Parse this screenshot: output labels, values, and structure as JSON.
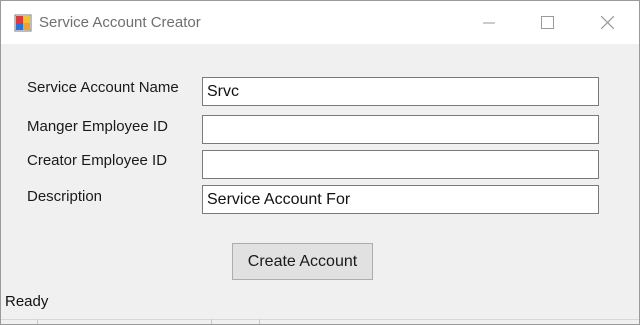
{
  "window": {
    "title": "Service Account Creator",
    "icon": "app-icon",
    "controls": {
      "minimize": "minimize-icon",
      "maximize": "maximize-icon",
      "close": "close-icon"
    }
  },
  "form": {
    "fields": [
      {
        "label": "Service Account Name",
        "value": "Srvc",
        "placeholder": ""
      },
      {
        "label": "Manger Employee ID",
        "value": "",
        "placeholder": ""
      },
      {
        "label": "Creator Employee ID",
        "value": "",
        "placeholder": ""
      },
      {
        "label": "Description",
        "value": "Service Account For",
        "placeholder": ""
      }
    ],
    "submit_label": "Create Account"
  },
  "status": {
    "text": "Ready"
  }
}
